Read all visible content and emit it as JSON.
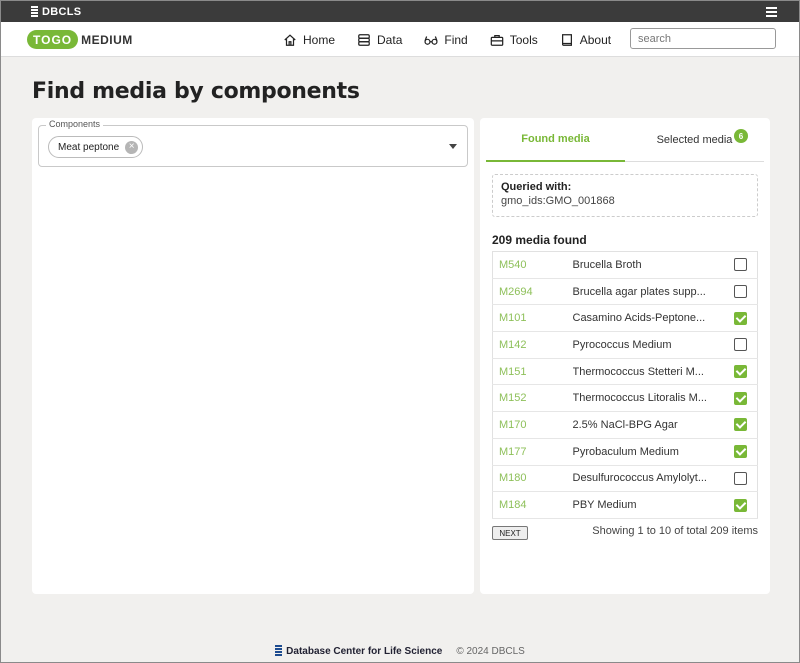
{
  "topbar": {
    "brand": "DBCLS"
  },
  "logo": {
    "part1": "TOGO",
    "part2": "MEDIUM"
  },
  "nav": [
    {
      "label": "Home",
      "icon": "home-icon"
    },
    {
      "label": "Data",
      "icon": "database-icon"
    },
    {
      "label": "Find",
      "icon": "glasses-icon"
    },
    {
      "label": "Tools",
      "icon": "toolbox-icon"
    },
    {
      "label": "About",
      "icon": "book-icon"
    }
  ],
  "search": {
    "placeholder": "search"
  },
  "page_title": "Find media by components",
  "components": {
    "label": "Components",
    "chips": [
      "Meat peptone"
    ]
  },
  "tabs": {
    "found": "Found media",
    "selected": "Selected media",
    "selected_count": "6"
  },
  "queried": {
    "title": "Queried with:",
    "value": "gmo_ids:GMO_001868"
  },
  "found_count": "209 media found",
  "media": [
    {
      "id": "M540",
      "name": "Brucella Broth",
      "checked": false
    },
    {
      "id": "M2694",
      "name": "Brucella agar plates supp...",
      "checked": false
    },
    {
      "id": "M101",
      "name": "Casamino Acids-Peptone...",
      "checked": true
    },
    {
      "id": "M142",
      "name": "Pyrococcus Medium",
      "checked": false
    },
    {
      "id": "M151",
      "name": "Thermococcus Stetteri M...",
      "checked": true
    },
    {
      "id": "M152",
      "name": "Thermococcus Litoralis M...",
      "checked": true
    },
    {
      "id": "M170",
      "name": "2.5% NaCl-BPG Agar",
      "checked": true
    },
    {
      "id": "M177",
      "name": "Pyrobaculum Medium",
      "checked": true
    },
    {
      "id": "M180",
      "name": "Desulfurococcus Amylolyt...",
      "checked": false
    },
    {
      "id": "M184",
      "name": "PBY Medium",
      "checked": true
    }
  ],
  "pagination": {
    "next_label": "NEXT",
    "showing": "Showing 1 to 10 of total 209 items"
  },
  "footer": {
    "org": "Database Center for Life Science",
    "copyright": "© 2024 DBCLS"
  },
  "colors": {
    "accent": "#79b837",
    "id_link": "#8ec05a",
    "topbar": "#3b3b3b"
  }
}
